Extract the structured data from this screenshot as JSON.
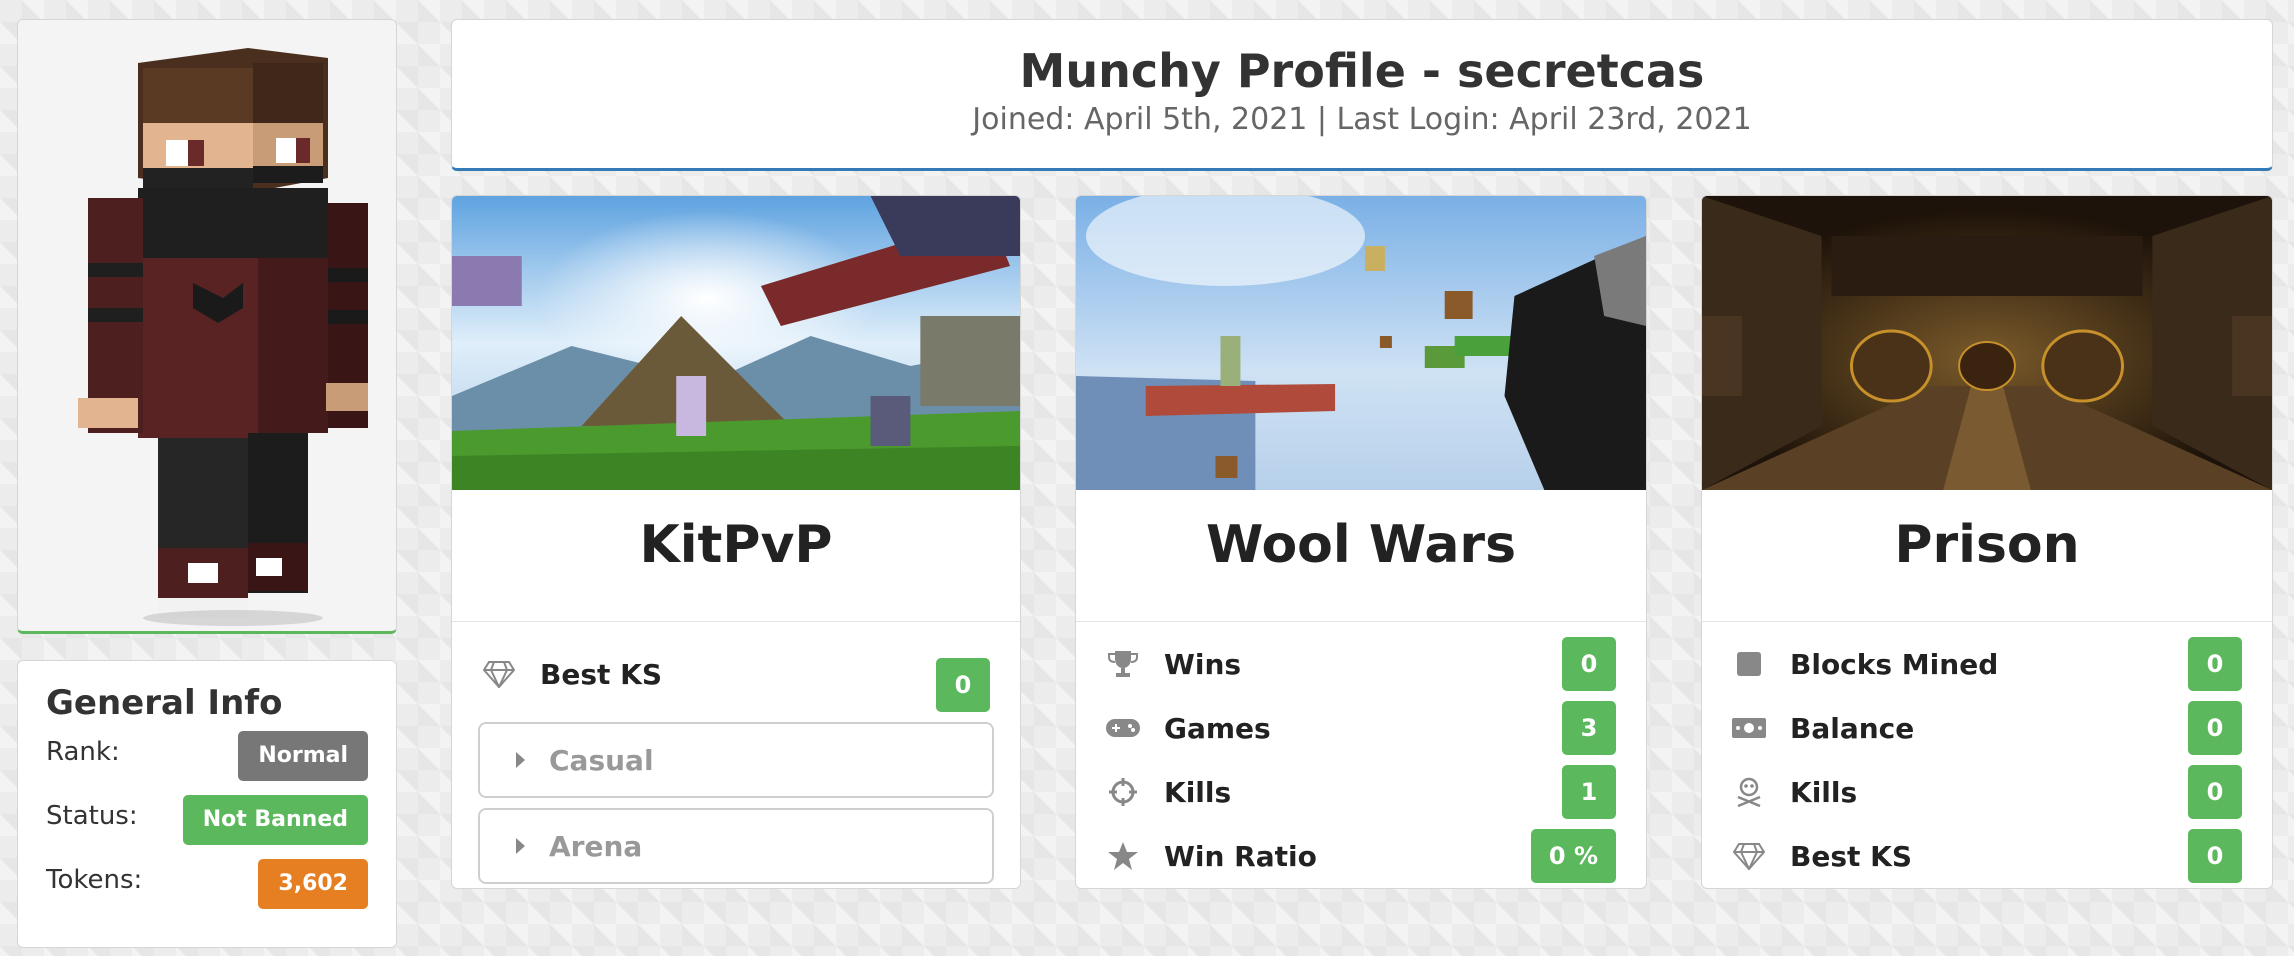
{
  "profile": {
    "title": "Munchy Profile - secretcas",
    "subtitle": "Joined: April 5th, 2021 | Last Login: April 23rd, 2021"
  },
  "general_info": {
    "heading": "General Info",
    "rows": [
      {
        "label": "Rank:",
        "value": "Normal",
        "color": "#777777"
      },
      {
        "label": "Status:",
        "value": "Not Banned",
        "color": "#5cb85c"
      },
      {
        "label": "Tokens:",
        "value": "3,602",
        "color": "#e67e22"
      }
    ]
  },
  "games": {
    "kitpvp": {
      "title": "KitPvP",
      "stats": [
        {
          "icon": "diamond-icon",
          "label": "Best KS",
          "value": "0"
        }
      ],
      "sections": [
        {
          "label": "Casual"
        },
        {
          "label": "Arena"
        }
      ]
    },
    "woolwars": {
      "title": "Wool Wars",
      "stats": [
        {
          "icon": "trophy-icon",
          "label": "Wins",
          "value": "0"
        },
        {
          "icon": "gamepad-icon",
          "label": "Games",
          "value": "3"
        },
        {
          "icon": "crosshairs-icon",
          "label": "Kills",
          "value": "1"
        },
        {
          "icon": "star-icon",
          "label": "Win Ratio",
          "value": "0 %"
        }
      ]
    },
    "prison": {
      "title": "Prison",
      "stats": [
        {
          "icon": "square-icon",
          "label": "Blocks Mined",
          "value": "0"
        },
        {
          "icon": "money-icon",
          "label": "Balance",
          "value": "0"
        },
        {
          "icon": "skull-crossbones-icon",
          "label": "Kills",
          "value": "0"
        },
        {
          "icon": "diamond-icon",
          "label": "Best KS",
          "value": "0"
        }
      ]
    }
  },
  "colors": {
    "accent_green": "#5cb85c",
    "accent_blue": "#337ab7",
    "accent_orange": "#e67e22"
  }
}
